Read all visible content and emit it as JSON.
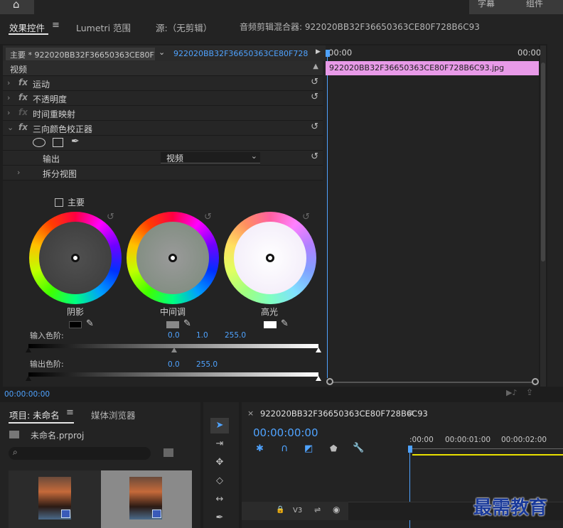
{
  "topbar": {
    "right_tabs": [
      "字幕",
      "组件"
    ]
  },
  "panel_tabs": {
    "effect_controls": "效果控件",
    "lumetri_scopes": "Lumetri 范围",
    "source": "源:（无剪辑）",
    "audio_mixer": "音频剪辑混合器: 922020BB32F36650363CE80F728B6C93"
  },
  "effect_controls": {
    "master_clip": "主要 * 922020BB32F36650363CE80F7...",
    "sequence_clip": "922020BB32F36650363CE80F728B...",
    "section_video": "视频",
    "effects": [
      {
        "label": "运动",
        "fx": "fx"
      },
      {
        "label": "不透明度",
        "fx": "fx"
      },
      {
        "label": "时间重映射",
        "fx": "fx"
      },
      {
        "label": "三向颜色校正器",
        "fx": "fx"
      }
    ],
    "output_label": "输出",
    "output_value": "视频",
    "split_view": "拆分视图",
    "master_checkbox": "主要",
    "wheels": [
      "阴影",
      "中间调",
      "高光"
    ],
    "input_levels_label": "输入色阶:",
    "input_levels": [
      "0.0",
      "1.0",
      "255.0"
    ],
    "output_levels_label": "输出色阶:",
    "output_levels": [
      "0.0",
      "255.0"
    ],
    "timecode": "00:00:00:00"
  },
  "mini_timeline": {
    "start": "00:00",
    "end": "00:00",
    "clip_name": "922020BB32F36650363CE80F728B6C93.jpg"
  },
  "project_panel": {
    "tab_project": "项目: 未命名",
    "tab_media_browser": "媒体浏览器",
    "project_file": "未命名.prproj",
    "search_placeholder": ""
  },
  "sequence_panel": {
    "tab_name": "922020BB32F36650363CE80F728B6C93",
    "timecode": "00:00:00:00",
    "ruler": [
      ":00:00",
      "00:00:01:00",
      "00:00:02:00"
    ],
    "track_label": "V3"
  },
  "watermark": "最需教育",
  "colors": {
    "accent": "#4fa3ff",
    "clip": "#e89ae8",
    "background": "#232323"
  }
}
